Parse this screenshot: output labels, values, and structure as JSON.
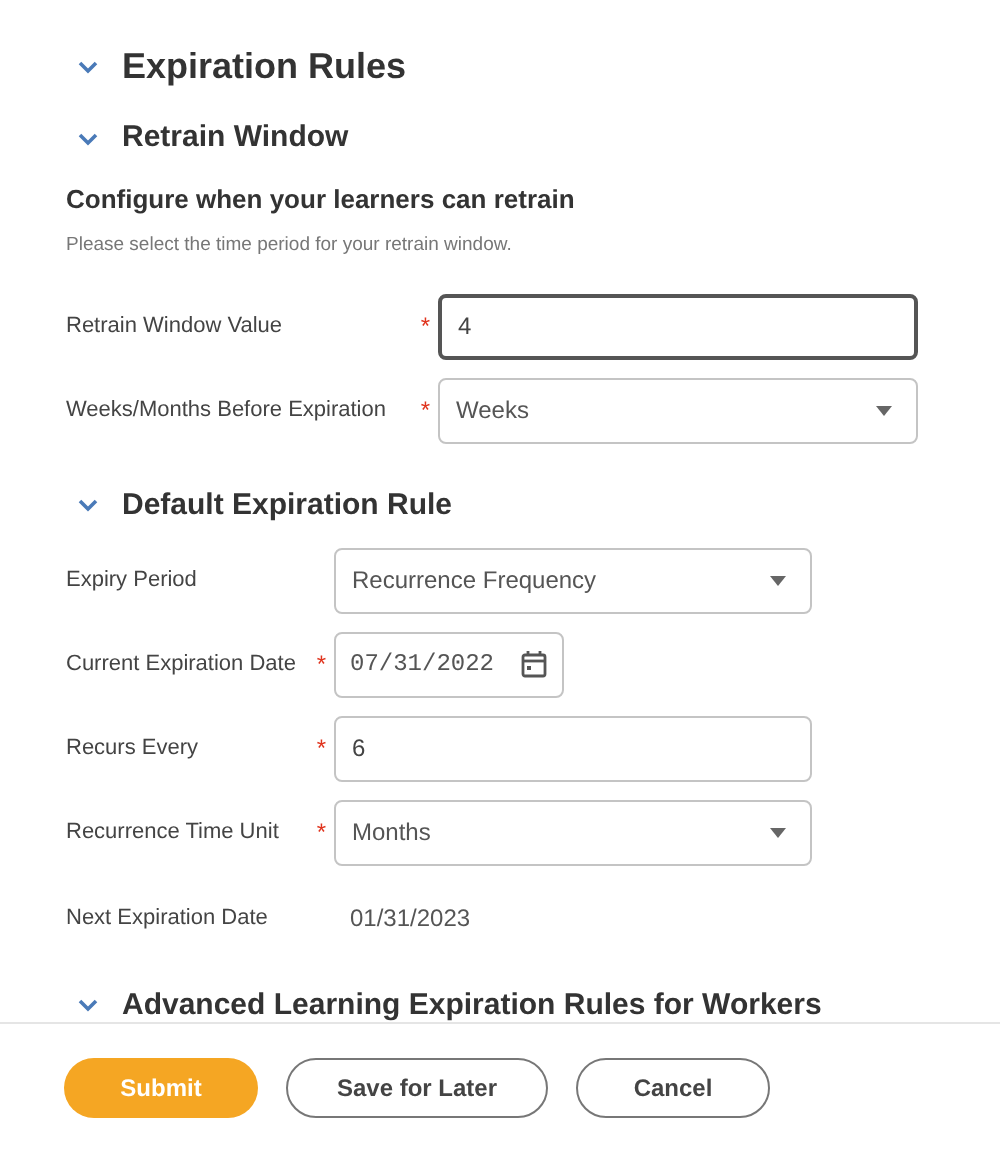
{
  "page_title": {
    "text": "Expiration Rules",
    "expanded": true
  },
  "sections": [
    {
      "title": "Retrain Window",
      "expanded": true,
      "intro": "Configure when your learners can retrain",
      "help": "Please select the time period for your retrain window.",
      "fields": [
        {
          "label": "Retrain Window Value",
          "required_mark": "*",
          "kind": "text",
          "value": "4",
          "focused": true
        },
        {
          "label": "Weeks/Months Before Expiration",
          "required_mark": "*",
          "kind": "select",
          "value": "Weeks",
          "focused": false
        }
      ]
    },
    {
      "title": "Default Expiration Rule",
      "expanded": true,
      "fields": [
        {
          "label": "Expiry Period",
          "kind": "select",
          "value": "Recurrence Frequency",
          "focused": false
        },
        {
          "label": "Current Expiration Date",
          "required_mark": "*",
          "kind": "date",
          "value": "07/31/2022",
          "focused": false
        },
        {
          "label": "Recurs Every",
          "required_mark": "*",
          "kind": "text",
          "value": "6",
          "focused": false
        },
        {
          "label": "Recurrence Time Unit",
          "required_mark": "*",
          "kind": "select",
          "value": "Months",
          "focused": false
        },
        {
          "label": "Next Expiration Date",
          "kind": "readonly",
          "value": "01/31/2023"
        }
      ]
    },
    {
      "title": "Advanced Learning Expiration Rules for Workers",
      "expanded": true
    }
  ],
  "buttons": [
    {
      "label": "Submit",
      "kind": "primary"
    },
    {
      "label": "Save for Later",
      "kind": "secondary"
    },
    {
      "label": "Cancel",
      "kind": "secondary"
    }
  ]
}
